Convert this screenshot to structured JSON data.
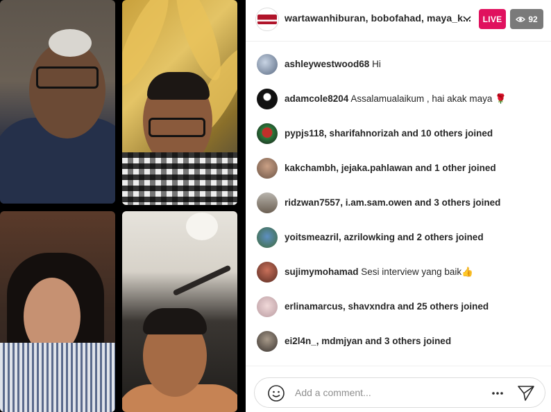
{
  "header": {
    "host_names": "wartawanhiburan, bobofahad, maya_k...",
    "live_label": "LIVE",
    "viewer_count": "92",
    "icons": {
      "dropdown": "chevron-down-icon",
      "viewers": "eye-icon"
    },
    "colors": {
      "live": "#e0115e",
      "viewers_badge": "#7a7a7a"
    }
  },
  "comments": [
    {
      "user": "ashleywestwood68",
      "message": "Hi",
      "type": "comment"
    },
    {
      "user": "adamcole8204",
      "message": "Assalamualaikum , hai akak maya 🌹",
      "type": "comment"
    },
    {
      "user": "pypjs118, sharifahnorizah and 10 others joined",
      "type": "join"
    },
    {
      "user": "kakchambh, jejaka.pahlawan and 1 other joined",
      "type": "join"
    },
    {
      "user": "ridzwan7557, i.am.sam.owen and 3 others joined",
      "type": "join"
    },
    {
      "user": "yoitsmeazril, azrilowking and 2 others joined",
      "type": "join"
    },
    {
      "user": "sujimymohamad",
      "message": "Sesi interview yang baik👍",
      "type": "comment"
    },
    {
      "user": "erlinamarcus, shavxndra and 25 others joined",
      "type": "join"
    },
    {
      "user": "ei2l4n_, mdmjyan and 3 others joined",
      "type": "join"
    }
  ],
  "composer": {
    "placeholder": "Add a comment...",
    "icons": {
      "emoji": "emoji-icon",
      "more": "more-options-icon",
      "send": "send-icon"
    }
  }
}
